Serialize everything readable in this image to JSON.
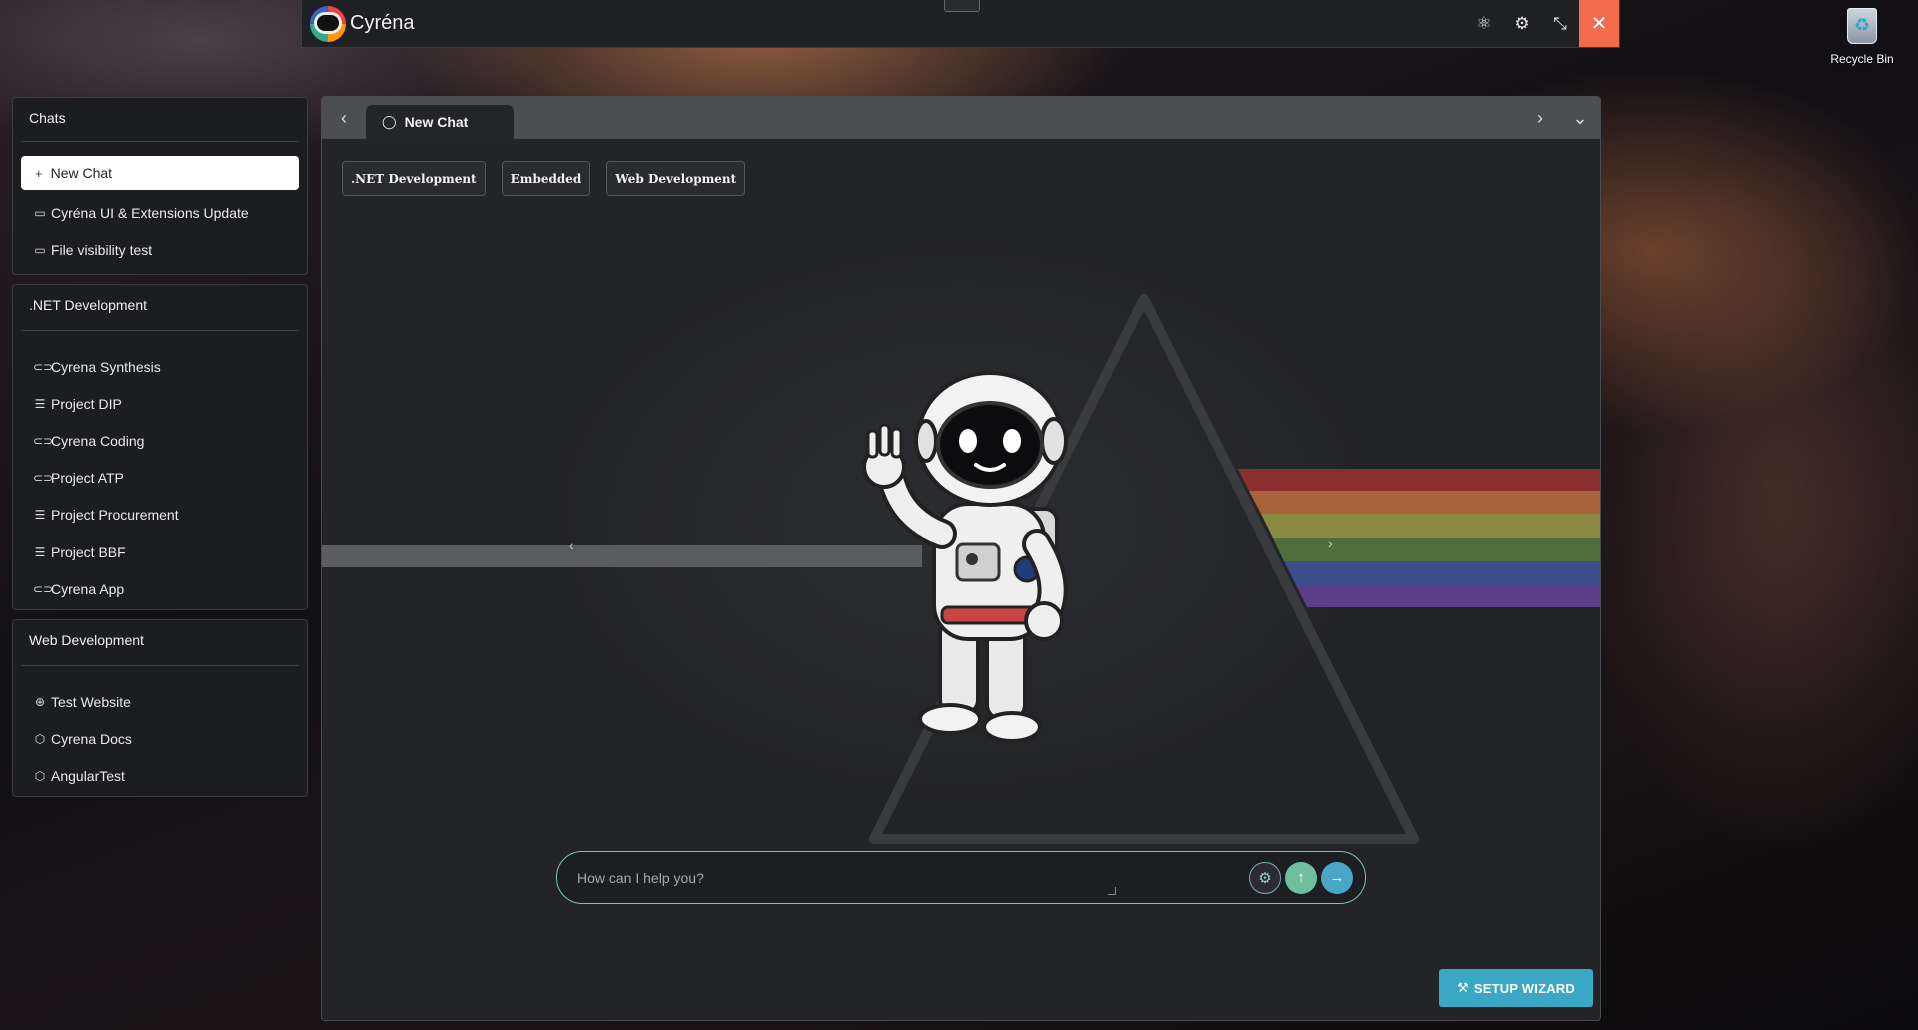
{
  "window": {
    "title": "Cyréna",
    "controls": {
      "close": "✕"
    }
  },
  "desktop": {
    "recycle_bin": "Recycle Bin"
  },
  "sidebar": {
    "chats": {
      "title": "Chats",
      "new_chat": "New Chat",
      "items": [
        {
          "label": "Cyréna UI & Extensions Update",
          "icon": "chat-bubble-icon"
        },
        {
          "label": "File visibility test",
          "icon": "chat-bubble-icon"
        }
      ]
    },
    "dotnet": {
      "title": ".NET Development",
      "items": [
        {
          "label": "Cyrena Synthesis",
          "icon": "link-icon"
        },
        {
          "label": "Project DIP",
          "icon": "server-icon"
        },
        {
          "label": "Cyrena Coding",
          "icon": "link-icon"
        },
        {
          "label": "Project ATP",
          "icon": "link-icon"
        },
        {
          "label": "Project Procurement",
          "icon": "server-icon"
        },
        {
          "label": "Project BBF",
          "icon": "server-icon"
        },
        {
          "label": "Cyrena App",
          "icon": "link-icon"
        }
      ]
    },
    "web": {
      "title": "Web Development",
      "items": [
        {
          "label": "Test Website",
          "icon": "globe-icon"
        },
        {
          "label": "Cyrena Docs",
          "icon": "box-icon"
        },
        {
          "label": "AngularTest",
          "icon": "box-icon"
        }
      ]
    }
  },
  "main": {
    "tab": {
      "label": "New Chat"
    },
    "chips": [
      ".NET Development",
      "Embedded",
      "Web Development"
    ],
    "input": {
      "placeholder": "How can I help you?"
    },
    "wizard_label": "SETUP WIZARD"
  },
  "colors": {
    "accent": "#3aa7c4",
    "close": "#f26b4d",
    "input_border": "#6fc9b8",
    "spectrum": [
      "#8b2e2e",
      "#a8633a",
      "#8a8a42",
      "#4e6f3a",
      "#3d4f8a",
      "#5a3e8a"
    ]
  }
}
